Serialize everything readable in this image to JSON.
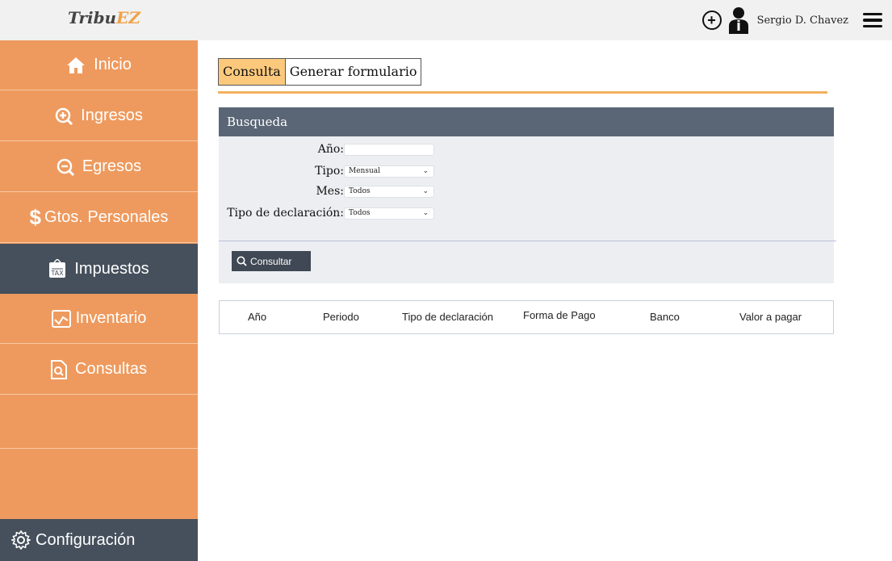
{
  "header": {
    "brand_main": "Tribu",
    "brand_accent": "EZ",
    "add_icon": "plus-circle-icon",
    "user_icon": "user-icon",
    "username": "Sergio D. Chavez",
    "menu_icon": "hamburger-icon"
  },
  "sidebar": {
    "items": [
      {
        "label": "Inicio",
        "icon": "home-icon"
      },
      {
        "label": "Ingresos",
        "icon": "zoom-in-icon"
      },
      {
        "label": "Egresos",
        "icon": "zoom-out-icon"
      },
      {
        "label": "Gtos. Personales",
        "icon": "dollar-icon"
      },
      {
        "label": "Impuestos",
        "icon": "tax-icon"
      },
      {
        "label": "Inventario",
        "icon": "chart-icon"
      },
      {
        "label": "Consultas",
        "icon": "document-search-icon"
      }
    ],
    "config_label": "Configuración",
    "config_icon": "gear-icon"
  },
  "tabs": [
    {
      "label": "Consulta",
      "active": true
    },
    {
      "label": "Generar formulario",
      "active": false
    }
  ],
  "search": {
    "title": "Busqueda",
    "fields": {
      "anio_label": "Año:",
      "anio_value": "",
      "tipo_label": "Tipo:",
      "tipo_value": "Mensual",
      "mes_label": "Mes:",
      "mes_value": "Todos",
      "tipo_decl_label": "Tipo de declaración:",
      "tipo_decl_value": "Todos"
    },
    "button_label": "Consultar"
  },
  "results_table": {
    "columns": [
      "Año",
      "Periodo",
      "Tipo de declaración",
      "Forma de Pago",
      "Banco",
      "Valor a pagar"
    ]
  },
  "colors": {
    "sidebar": "#ee9a5e",
    "active": "#46505c",
    "accent": "#fcc97c"
  }
}
